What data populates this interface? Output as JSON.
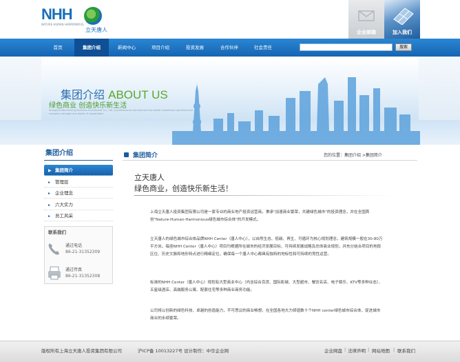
{
  "logo": {
    "mark": "NHH",
    "subtitle": "NATURE HUMAN HARMONIOUS",
    "chinese": "立天唐人"
  },
  "header_links": {
    "mail": "企业邮箱",
    "join": "加入我们"
  },
  "nav": {
    "items": [
      "首页",
      "集团介绍",
      "新闻中心",
      "项目介绍",
      "投资发展",
      "合作伙伴",
      "社会责任"
    ],
    "active_index": 1
  },
  "search": {
    "button": "搜索",
    "value": ""
  },
  "banner": {
    "title_cn": "集团介绍",
    "title_en": "ABOUT US",
    "slogan": "绿色商业 创造快乐新生活",
    "small_text": "Shanghai Wenchuang Business Investment Co., Ltd.,a professional commercial real estate investment operators,the company strength and depth of cooperation"
  },
  "sidebar": {
    "title": "集团介绍",
    "items": [
      "集团简介",
      "管理层",
      "企业理念",
      "六大实力",
      "员工风采"
    ],
    "active_index": 0,
    "contact_title": "联系我们",
    "phone_label": "通过电话",
    "phone_value": "86-21-31352309",
    "fax_label": "通过传真",
    "fax_value": "86-21-31352308"
  },
  "main": {
    "section_title": "集团简介",
    "breadcrumb": "您的位置：集团介绍 >集团简介",
    "headline_1": "立天唐人",
    "headline_2": "绿色商业，创造快乐新生活！",
    "paragraphs": [
      "上海立天唐人投资集团有限公司是一家专业的商业地产投资运营商，秉承\"加速商业繁荣，共建绿色城市\"的投资理念，并在全国首创\"Nature-Human-Harmonious绿色城市综合体\"的开发模式。",
      "立天唐人的绿色城市综合体品牌NHH Center（唐人中心），以自然生态、低碳、再生、可循环为核心规划理念，建筑规模一般在30-80万平方米。每座NHH Center（唐人中心）项目均根据所在城市的经济发展目标、可持续发展战略及总体商业规划，并充分结合项目的地段区位、历史文脉和地形特点进行精细定位，确保每一个唐人中心都具有独特的地标性和可持续的竞性运营。",
      "标准的NHH Center（唐人中心）规划有大型商业中心（内含综合百货、国际影城、大型超市、餐饮名店、电子娱乐、KTV等多种业态）、五星级酒店、高端服务公寓、配套住宅等多种商业商务功能。",
      "公司将以创新的绿色科技、卓越的创造能力，不可思议的商业畅想，在全国各地大力缔造数十个NHH center绿色城市综合体，促进城市商业的永续繁荣。"
    ]
  },
  "footer": {
    "copyright": "版权所有上海立天唐人投资集团有限公司",
    "icp": "沪ICP备 10013227号 设计制作：中华企业网",
    "links": [
      "企业网盘",
      "法律声明",
      "网站地图",
      "联系我们"
    ]
  },
  "colors": {
    "nav_blue": "#1565b3",
    "brand_blue": "#1d5c9e",
    "brand_green": "#4a9a2c"
  }
}
